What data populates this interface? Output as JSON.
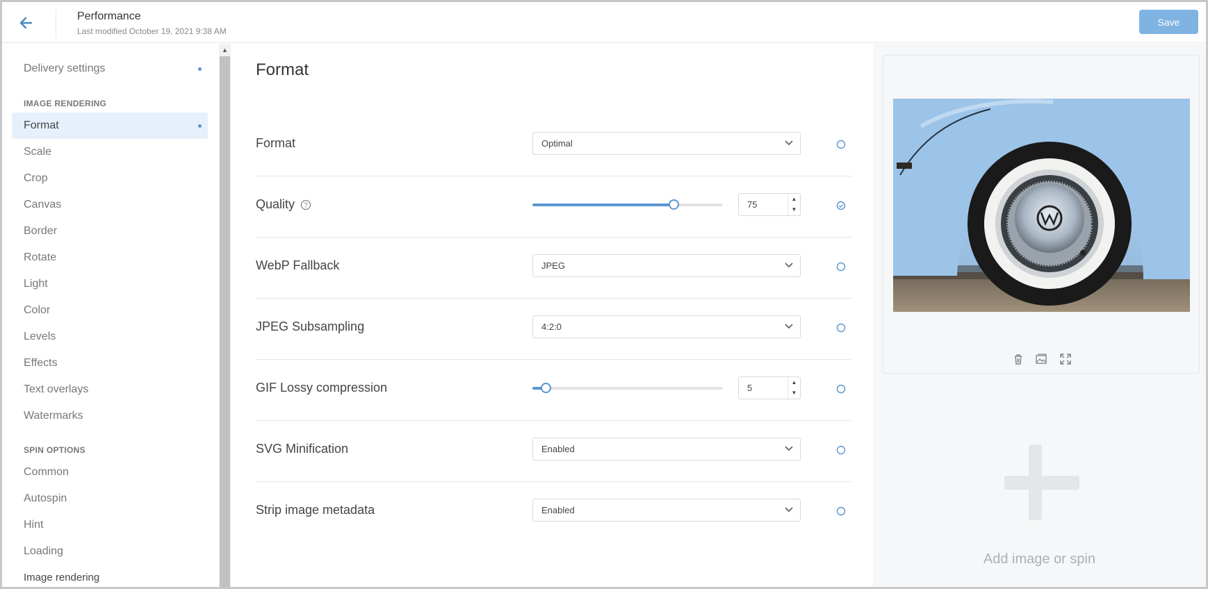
{
  "header": {
    "title": "Performance",
    "last_modified": "Last modified October 19, 2021 9:38 AM",
    "save_label": "Save"
  },
  "sidebar": {
    "top_item": "Delivery settings",
    "image_rendering_heading": "IMAGE RENDERING",
    "image_rendering_items": [
      "Format",
      "Scale",
      "Crop",
      "Canvas",
      "Border",
      "Rotate",
      "Light",
      "Color",
      "Levels",
      "Effects",
      "Text overlays",
      "Watermarks"
    ],
    "spin_options_heading": "SPIN OPTIONS",
    "spin_options_items": [
      "Common",
      "Autospin",
      "Hint",
      "Loading"
    ],
    "bottom_item": "Image rendering",
    "active_item": "Format"
  },
  "main": {
    "title": "Format",
    "rows": [
      {
        "label": "Format",
        "control": "select",
        "value": "Optimal",
        "status": "unset"
      },
      {
        "label": "Quality",
        "control": "slider",
        "value": "75",
        "slider_percent": 74,
        "status": "set",
        "has_help": true
      },
      {
        "label": "WebP Fallback",
        "control": "select",
        "value": "JPEG",
        "status": "unset"
      },
      {
        "label": "JPEG Subsampling",
        "control": "select",
        "value": "4:2:0",
        "status": "unset"
      },
      {
        "label": "GIF Lossy compression",
        "control": "slider",
        "value": "5",
        "slider_percent": 7,
        "status": "unset"
      },
      {
        "label": "SVG Minification",
        "control": "select",
        "value": "Enabled",
        "status": "unset"
      },
      {
        "label": "Strip image metadata",
        "control": "select",
        "value": "Enabled",
        "status": "unset"
      }
    ]
  },
  "preview": {
    "tools": [
      "trash-icon",
      "image-gallery-icon",
      "expand-icon"
    ],
    "add_label": "Add image or spin"
  },
  "colors": {
    "accent": "#5a95d2",
    "save_button": "#7fb3e2",
    "active_bg": "#e6f0fb"
  }
}
